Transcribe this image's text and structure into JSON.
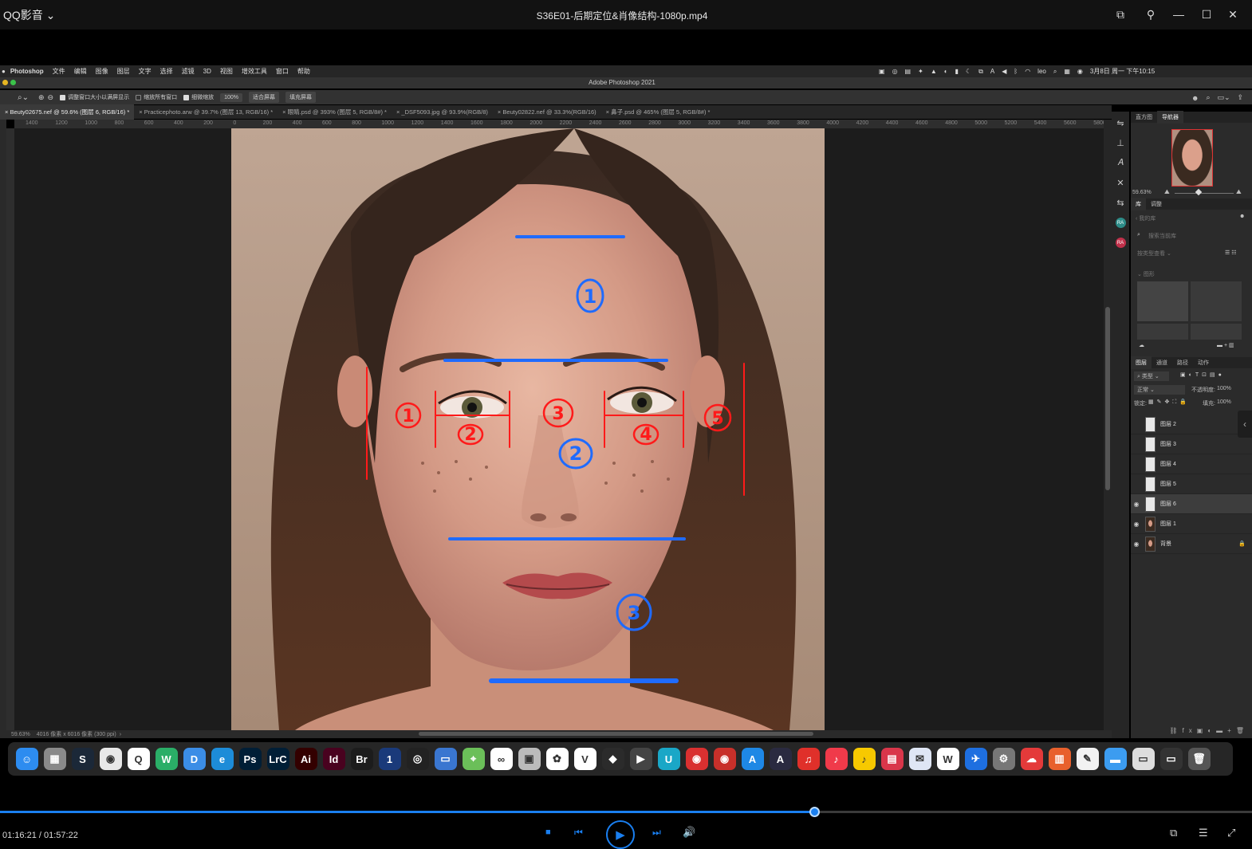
{
  "player": {
    "brand": "QQ影音",
    "video_title": "S36E01-后期定位&肖像结构-1080p.mp4",
    "time": "01:16:21 / 01:57:22",
    "progress": 0.6505
  },
  "mac_menubar": {
    "app": "Photoshop",
    "items": [
      "文件",
      "编辑",
      "图像",
      "图层",
      "文字",
      "选择",
      "滤镜",
      "3D",
      "视图",
      "增效工具",
      "窗口",
      "帮助"
    ],
    "user": "leo",
    "clock": "3月8日 周一 下午10:15"
  },
  "ps": {
    "window_title": "Adobe Photoshop 2021",
    "options": {
      "resize_windows": "调整窗口大小以满屏显示",
      "zoom_all": "缩放所有窗口",
      "scrubby_zoom": "细微缩放",
      "zoom_value": "100%",
      "fit_screen": "适合屏幕",
      "fill_screen": "填充屏幕"
    },
    "tabs": [
      "Beuty02675.nef @ 59.6% (图层 6, RGB/16) *",
      "Practicephoto.arw @ 39.7% (图层 13, RGB/16) *",
      "眼睛.psd @ 393% (图层 5, RGB/8#) *",
      "_DSF5093.jpg @ 93.9%(RGB/8)",
      "Beuty02822.nef @ 33.3%(RGB/16)",
      "鼻子.psd @ 465% (图层 5, RGB/8#) *"
    ],
    "ruler_labels": [
      "1400",
      "1200",
      "1000",
      "800",
      "600",
      "400",
      "200",
      "0",
      "200",
      "400",
      "600",
      "800",
      "1000",
      "1200",
      "1400",
      "1600",
      "1800",
      "2000",
      "2200",
      "2400",
      "2600",
      "2800",
      "3000",
      "3200",
      "3400",
      "3600",
      "3800",
      "4000",
      "4200",
      "4400",
      "4600",
      "4800",
      "5000",
      "5200",
      "5400",
      "5600",
      "5800"
    ],
    "status": {
      "zoom": "59.63%",
      "doc": "4016 像素 x 6016 像素 (300 ppi)"
    },
    "panels": {
      "top_tabs": [
        "直方图",
        "导航器"
      ],
      "nav_zoom": "59.63%",
      "mid_tabs": [
        "库",
        "调整"
      ],
      "library_back": "我的库",
      "library_search": "搜索当前库",
      "library_sort": "按类型查看",
      "library_group": "图形",
      "layer_tabs": [
        "图层",
        "通道",
        "路径",
        "动作"
      ],
      "filter_kind": "类型",
      "blend_mode": "正常",
      "opacity_label": "不透明度:",
      "opacity": "100%",
      "lock_label": "锁定:",
      "fill_label": "填充:",
      "fill": "100%",
      "layers": [
        {
          "name": "图层 2",
          "visible": false,
          "selected": false,
          "thumb": "blank"
        },
        {
          "name": "图层 3",
          "visible": false,
          "selected": false,
          "thumb": "blank"
        },
        {
          "name": "图层 4",
          "visible": false,
          "selected": false,
          "thumb": "blank"
        },
        {
          "name": "图层 5",
          "visible": false,
          "selected": false,
          "thumb": "blank"
        },
        {
          "name": "图层 6",
          "visible": true,
          "selected": true,
          "thumb": "blank"
        },
        {
          "name": "图层 1",
          "visible": true,
          "selected": false,
          "thumb": "face"
        },
        {
          "name": "背景",
          "visible": true,
          "selected": false,
          "thumb": "face"
        }
      ]
    }
  },
  "annotations": {
    "red_numbers": [
      "1",
      "2",
      "3",
      "4",
      "5"
    ],
    "blue_numbers": [
      "1",
      "2",
      "3"
    ]
  },
  "dock": [
    {
      "name": "finder",
      "label": "☺",
      "color": "#2d8cf0"
    },
    {
      "name": "launchpad",
      "label": "▦",
      "color": "#8a8a8a"
    },
    {
      "name": "steam",
      "label": "S",
      "color": "#1b2838"
    },
    {
      "name": "chrome",
      "label": "◉",
      "color": "#e8e8e8"
    },
    {
      "name": "qq",
      "label": "Q",
      "color": "#ffffff"
    },
    {
      "name": "wechat",
      "label": "W",
      "color": "#2aae67"
    },
    {
      "name": "dingtalk",
      "label": "D",
      "color": "#3b8de6"
    },
    {
      "name": "edge",
      "label": "e",
      "color": "#1d8cd8"
    },
    {
      "name": "photoshop",
      "label": "Ps",
      "color": "#001e36"
    },
    {
      "name": "lightroom-classic",
      "label": "LrC",
      "color": "#001e36"
    },
    {
      "name": "illustrator",
      "label": "Ai",
      "color": "#330000"
    },
    {
      "name": "indesign",
      "label": "Id",
      "color": "#49021f"
    },
    {
      "name": "bridge",
      "label": "Br",
      "color": "#1c1c1c"
    },
    {
      "name": "1password",
      "label": "1",
      "color": "#1a3a7a"
    },
    {
      "name": "obs",
      "label": "◎",
      "color": "#222222"
    },
    {
      "name": "remote-desktop",
      "label": "▭",
      "color": "#3a76d0"
    },
    {
      "name": "maps",
      "label": "⌖",
      "color": "#6bbf59"
    },
    {
      "name": "baidu-netdisk",
      "label": "∞",
      "color": "#ffffff"
    },
    {
      "name": "image-capture",
      "label": "▣",
      "color": "#bbbbbb"
    },
    {
      "name": "photos",
      "label": "✿",
      "color": "#ffffff"
    },
    {
      "name": "vivaldi",
      "label": "V",
      "color": "#ffffff"
    },
    {
      "name": "navicat",
      "label": "◆",
      "color": "#2b2b2b"
    },
    {
      "name": "final-cut",
      "label": "▶",
      "color": "#444444"
    },
    {
      "name": "u-app",
      "label": "U",
      "color": "#1aa7c7"
    },
    {
      "name": "podcast-red",
      "label": "◉",
      "color": "#d93030"
    },
    {
      "name": "netease-podcast",
      "label": "◉",
      "color": "#c8302a"
    },
    {
      "name": "app-store",
      "label": "A",
      "color": "#1e88e5"
    },
    {
      "name": "affinity",
      "label": "A",
      "color": "#2a2a40"
    },
    {
      "name": "netease-music",
      "label": "♫",
      "color": "#e0302a"
    },
    {
      "name": "apple-music",
      "label": "♪",
      "color": "#f03a4a"
    },
    {
      "name": "qq-music",
      "label": "♪",
      "color": "#f7c900"
    },
    {
      "name": "radio",
      "label": "▤",
      "color": "#d9364a"
    },
    {
      "name": "mail-app",
      "label": "✉",
      "color": "#dfe6f5"
    },
    {
      "name": "w-app",
      "label": "W",
      "color": "#ffffff"
    },
    {
      "name": "spark",
      "label": "✈",
      "color": "#1e6fe0"
    },
    {
      "name": "system-preferences",
      "label": "⚙",
      "color": "#777777"
    },
    {
      "name": "creative-cloud",
      "label": "☁",
      "color": "#e43a3a"
    },
    {
      "name": "sketch-books",
      "label": "▥",
      "color": "#e8602c"
    },
    {
      "name": "textedit",
      "label": "✎",
      "color": "#f2f2f2"
    },
    {
      "name": "folder",
      "label": "▬",
      "color": "#3c9cf0"
    },
    {
      "name": "preview",
      "label": "▭",
      "color": "#dddddd"
    },
    {
      "name": "screen-app",
      "label": "▭",
      "color": "#333333"
    },
    {
      "name": "trash",
      "label": "🗑",
      "color": "#555555"
    }
  ],
  "colors": {
    "accent": "#1a7ff0",
    "annotation_red": "#ff1a1a",
    "annotation_blue": "#1f6bff"
  }
}
